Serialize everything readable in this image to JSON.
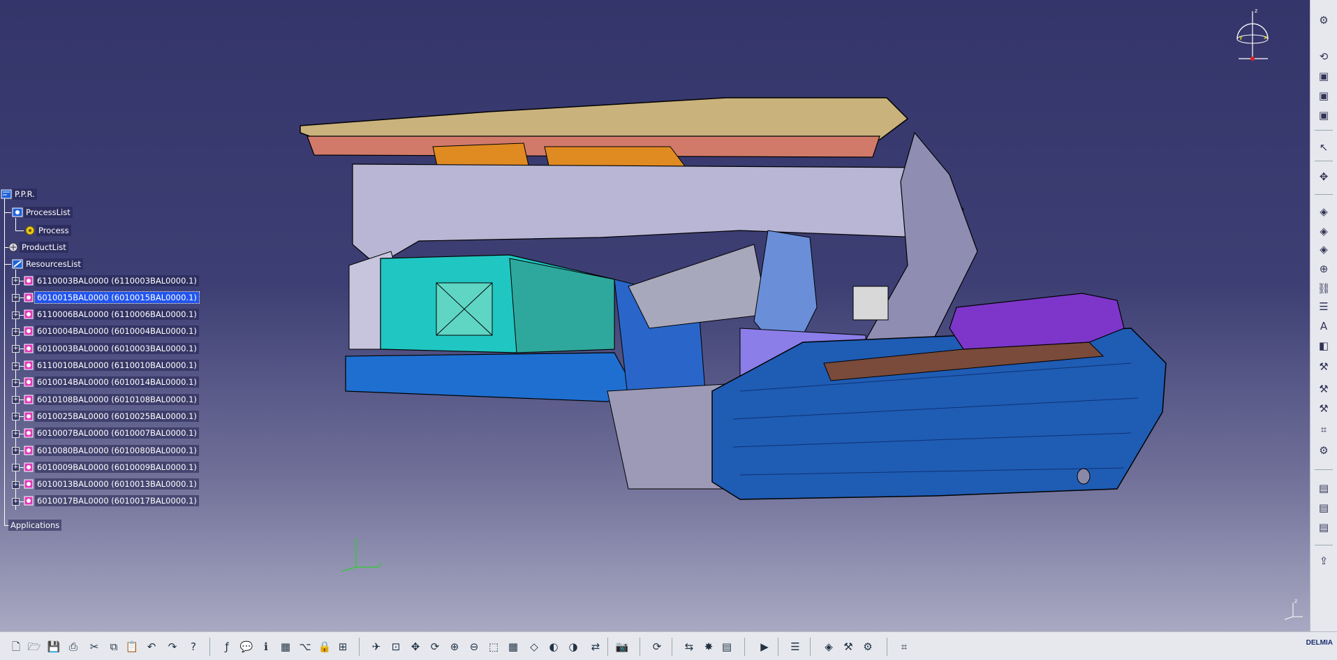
{
  "tree": {
    "root": "P.P.R.",
    "process_list": "ProcessList",
    "process": "Process",
    "product_list": "ProductList",
    "resources_list": "ResourcesList",
    "resources": [
      {
        "label": "6110003BAL0000 (6110003BAL0000.1)",
        "selected": false
      },
      {
        "label": "6010015BAL0000 (6010015BAL0000.1)",
        "selected": true
      },
      {
        "label": "6110006BAL0000 (6110006BAL0000.1)",
        "selected": false
      },
      {
        "label": "6010004BAL0000 (6010004BAL0000.1)",
        "selected": false
      },
      {
        "label": "6010003BAL0000 (6010003BAL0000.1)",
        "selected": false
      },
      {
        "label": "6110010BAL0000 (6110010BAL0000.1)",
        "selected": false
      },
      {
        "label": "6010014BAL0000 (6010014BAL0000.1)",
        "selected": false
      },
      {
        "label": "6010108BAL0000 (6010108BAL0000.1)",
        "selected": false
      },
      {
        "label": "6010025BAL0000 (6010025BAL0000.1)",
        "selected": false
      },
      {
        "label": "6010007BAL0000 (6010007BAL0000.1)",
        "selected": false
      },
      {
        "label": "6010080BAL0000 (6010080BAL0000.1)",
        "selected": false
      },
      {
        "label": "6010009BAL0000 (6010009BAL0000.1)",
        "selected": false
      },
      {
        "label": "6010013BAL0000 (6010013BAL0000.1)",
        "selected": false
      },
      {
        "label": "6010017BAL0000 (6010017BAL0000.1)",
        "selected": false
      }
    ],
    "applications": "Applications"
  },
  "compass_labels": {
    "z": "z",
    "x": "x",
    "y": "y"
  },
  "brand": "DELMIA",
  "colors": {
    "viewport_top": "#34356a",
    "viewport_bottom": "#a9a9c3",
    "selection": "#2255ee",
    "toolbar_bg": "#e6e8ee"
  },
  "right_toolbar_icons": [
    "settings-icon",
    "undo-view-icon",
    "view-icon",
    "view-icon",
    "view-icon",
    "select-icon",
    "manipulate-icon",
    "resource-icon",
    "resource-icon",
    "resource-icon",
    "insert-icon",
    "link-icon",
    "catalog-icon",
    "text-icon",
    "analysis-icon",
    "device-icon",
    "device-icon",
    "device-icon",
    "grid-icon",
    "robot-icon",
    "process-icon",
    "process-icon",
    "process-icon",
    "export-icon"
  ],
  "bottom_toolbar_icons": [
    "new-icon",
    "open-icon",
    "save-icon",
    "print-icon",
    "cut-icon",
    "copy-icon",
    "paste-icon",
    "undo-icon",
    "redo-icon",
    "help-icon",
    "formula-icon",
    "comment-icon",
    "knowledge-icon",
    "table-icon",
    "tree-icon",
    "lock-icon",
    "measure-icon",
    "fly-icon",
    "fit-all-icon",
    "pan-icon",
    "rotate-icon",
    "zoom-in-icon",
    "zoom-out-icon",
    "normal-view-icon",
    "multi-view-icon",
    "iso-view-icon",
    "shading-icon",
    "hide-show-icon",
    "swap-icon",
    "capture-icon",
    "update-icon",
    "compare-icon",
    "clash-icon",
    "sectioning-icon",
    "simulation-icon",
    "catalog-icon",
    "resource-icon",
    "device-icon",
    "robot-icon",
    "grid-icon"
  ]
}
